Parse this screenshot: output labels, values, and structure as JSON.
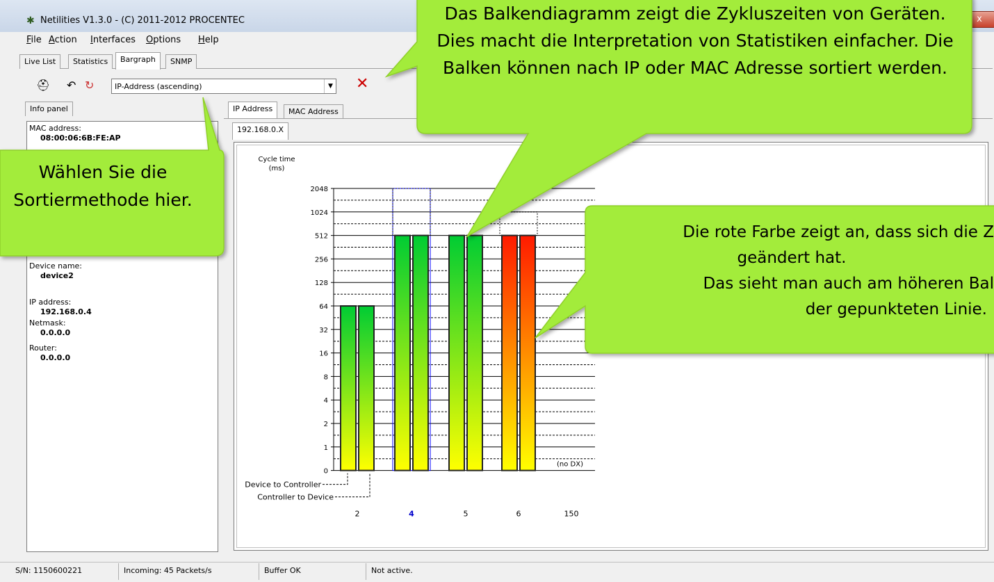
{
  "window": {
    "title": "Netilities V1.3.0 - (C) 2011-2012 PROCENTEC",
    "app_icon": "netilities-app-icon",
    "close": "x"
  },
  "menu": {
    "items": [
      {
        "label": "File",
        "key": "F"
      },
      {
        "label": "Action",
        "key": "A"
      },
      {
        "label": "Interfaces",
        "key": "I"
      },
      {
        "label": "Options",
        "key": "O"
      },
      {
        "label": "Help",
        "key": "H"
      }
    ]
  },
  "main_tabs": {
    "items": [
      "Live List",
      "Statistics",
      "Bargraph",
      "SNMP"
    ],
    "active": "Bargraph"
  },
  "toolbar": {
    "icons": [
      "binoculars-icon",
      "undo-icon",
      "refresh-icon",
      "delete-icon"
    ],
    "sort_select_value": "IP-Address (ascending)"
  },
  "info_panel": {
    "tab_label": "Info panel",
    "mac_label": "MAC address:",
    "mac_value": "08:00:06:6B:FE:AP",
    "device_name_label": "Device name:",
    "device_name_value": "device2",
    "ip_label": "IP address:",
    "ip_value": "192.168.0.4",
    "netmask_label": "Netmask:",
    "netmask_value": "0.0.0.0",
    "router_label": "Router:",
    "router_value": "0.0.0.0"
  },
  "chart_tabs": {
    "items": [
      "IP Address",
      "MAC Address"
    ],
    "active": "IP Address",
    "subtab": "192.168.0.X"
  },
  "chart_data": {
    "type": "bar",
    "ylabel_line1": "Cycle time",
    "ylabel_line2": "(ms)",
    "yscale": "log2",
    "yticks": [
      "2048",
      "1024",
      "512",
      "256",
      "128",
      "64",
      "32",
      "16",
      "8",
      "4",
      "2",
      "1",
      "0"
    ],
    "categories": [
      "2",
      "4",
      "5",
      "6",
      "150"
    ],
    "highlighted_category": "4",
    "series": [
      {
        "name": "Device to Controller",
        "values": [
          64,
          512,
          512,
          512,
          null
        ]
      },
      {
        "name": "Controller to Device",
        "values": [
          64,
          512,
          512,
          512,
          null
        ]
      }
    ],
    "previous_max": [
      null,
      2048,
      null,
      1024,
      null
    ],
    "changed": [
      false,
      false,
      false,
      true,
      false
    ],
    "no_dx_label": "(no DX)",
    "legend_dc": "Device to Controller",
    "legend_cd": "Controller to Device",
    "colors": {
      "normal_top": "#00cc33",
      "normal_bottom": "#ffff00",
      "changed_top": "#ff1a00",
      "changed_bottom": "#ffff00",
      "selected_outline": "#0000ff",
      "highlight_label": "#0000cc"
    }
  },
  "statusbar": {
    "serial": "S/N: 1150600221",
    "incoming": "Incoming: 45 Packets/s",
    "buffer": "Buffer OK",
    "state": "Not active."
  },
  "callouts": {
    "top_text": "Das Balkendiagramm zeigt die Zykluszeiten von Geräten. Dies macht die Interpretation von Statistiken einfacher. Die Balken können nach IP oder MAC Adresse sortiert werden.",
    "left_text": "Wählen Sie die Sortiermethode hier.",
    "right_line1": "Die rote Farbe zeigt an, dass sich die Z",
    "right_line2": "geändert hat.",
    "right_line3": "Das sieht man auch am höheren Bal",
    "right_line4": "der gepunkteten Linie.",
    "fill": "#a3ec3a"
  }
}
